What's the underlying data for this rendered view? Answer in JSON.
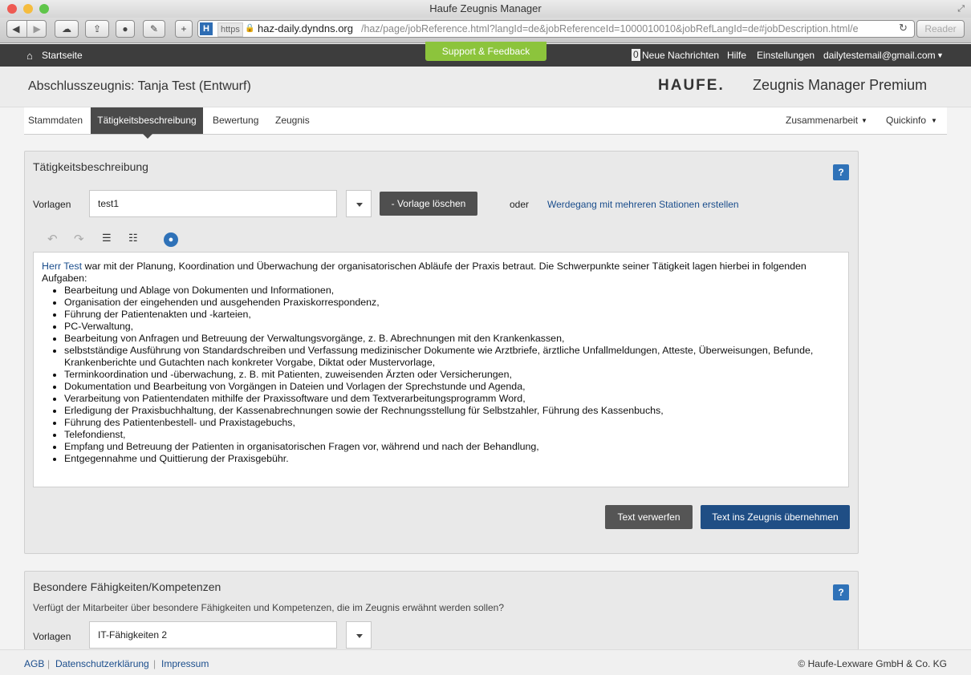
{
  "window": {
    "title": "Haufe Zeugnis Manager"
  },
  "browser": {
    "url_scheme": "https",
    "url_domain": "haz-daily.dyndns.org",
    "url_path": "/haz/page/jobReference.html?langId=de&jobReferenceId=1000010010&jobRefLangId=de#jobDescription.html/e",
    "reader_label": "Reader",
    "favicon_letter": "H"
  },
  "nav": {
    "home": "Startseite",
    "support": "Support & Feedback",
    "msg_count": "0",
    "messages": "Neue Nachrichten",
    "help": "Hilfe",
    "settings": "Einstellungen",
    "user": "dailytestemail@gmail.com"
  },
  "header": {
    "title": "Abschlusszeugnis: Tanja Test (Entwurf)",
    "brand_logo": "HAUFE.",
    "brand_product": "Zeugnis Manager Premium"
  },
  "tabs": [
    {
      "label": "Stammdaten"
    },
    {
      "label": "Tätigkeitsbeschreibung"
    },
    {
      "label": "Bewertung"
    },
    {
      "label": "Zeugnis"
    }
  ],
  "tabs_right": {
    "collab": "Zusammenarbeit",
    "quickinfo": "Quickinfo"
  },
  "panel1": {
    "title": "Tätigkeitsbeschreibung",
    "help": "?",
    "templates_label": "Vorlagen",
    "template_value": "test1",
    "delete_btn": "- Vorlage löschen",
    "or": "oder",
    "career_link": "Werdegang mit mehreren Stationen erstellen",
    "editor_name": "Herr Test",
    "editor_intro": " war mit der Planung, Koordination und Überwachung der organisatorischen Abläufe der Praxis betraut. Die Schwerpunkte seiner Tätigkeit lagen hierbei in folgenden Aufgaben:",
    "items": [
      "Bearbeitung und Ablage von Dokumenten und Informationen,",
      "Organisation der eingehenden und ausgehenden Praxiskorrespondenz,",
      "Führung der Patientenakten und -karteien,",
      "PC-Verwaltung,",
      "Bearbeitung von Anfragen und Betreuung der Verwaltungsvorgänge, z. B. Abrechnungen mit den Krankenkassen,",
      "selbstständige Ausführung von Standardschreiben und Verfassung medizinischer Dokumente wie Arztbriefe, ärztliche Unfallmeldungen, Atteste, Überweisungen, Befunde, Krankenberichte und Gutachten nach konkreter Vorgabe, Diktat oder Mustervorlage,",
      "Terminkoordination und -überwachung, z. B. mit Patienten, zuweisenden Ärzten oder Versicherungen,",
      "Dokumentation und Bearbeitung von Vorgängen in Dateien und Vorlagen der Sprechstunde und Agenda,",
      "Verarbeitung von Patientendaten mithilfe der Praxissoftware und dem Textverarbeitungsprogramm Word,",
      "Erledigung der Praxisbuchhaltung, der Kassenabrechnungen sowie der Rechnungsstellung für Selbstzahler, Führung des Kassenbuchs,",
      "Führung des Patientenbestell- und Praxistagebuchs,",
      "Telefondienst,",
      "Empfang und Betreuung der Patienten in organisatorischen Fragen vor, während und nach der Behandlung,",
      "Entgegennahme und Quittierung der Praxisgebühr."
    ],
    "discard_btn": "Text verwerfen",
    "apply_btn": "Text ins Zeugnis übernehmen"
  },
  "panel2": {
    "title": "Besondere Fähigkeiten/Kompetenzen",
    "help": "?",
    "question": "Verfügt der Mitarbeiter über besondere Fähigkeiten und Kompetenzen, die im Zeugnis erwähnt werden sollen?",
    "templates_label": "Vorlagen",
    "template_value": "IT-Fähigkeiten 2"
  },
  "footer": {
    "agb": "AGB",
    "privacy": "Datenschutzerklärung",
    "imprint": "Impressum",
    "sep": "|",
    "copyright": "© Haufe-Lexware GmbH & Co. KG"
  },
  "colors": {
    "accent_blue": "#1f4e85",
    "support_green": "#8cc43c",
    "nav_dark": "#3d3d3d"
  }
}
